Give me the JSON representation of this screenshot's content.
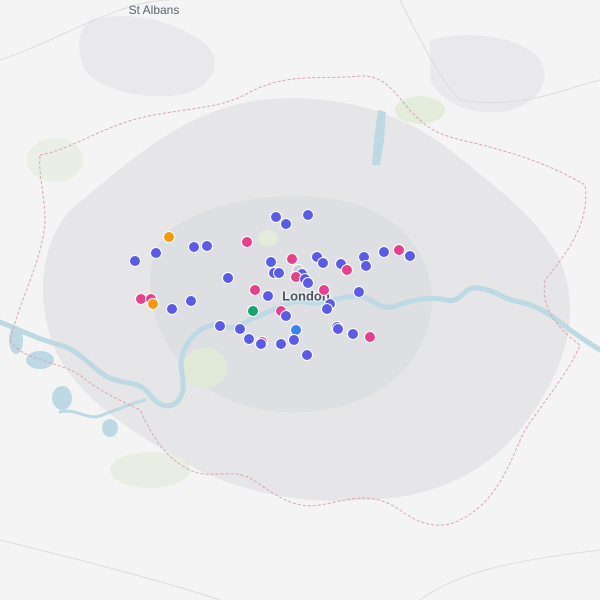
{
  "places": {
    "st_albans": "St Albans",
    "london": "London"
  },
  "colors": {
    "land": "#f4f4f4",
    "urban": "#e3e3e5",
    "park": "#e4eddc",
    "water": "#bcd9e4",
    "boundary": "#d9a4a8",
    "purple": "#5b5ce6",
    "pink": "#e5418c",
    "orange": "#f19a0f",
    "green": "#1aa36e",
    "blue": "#3b82f0",
    "grey": "#c8d0dc"
  },
  "markers": [
    {
      "color": "purple",
      "lat": 51.6335,
      "lon": -0.2133
    },
    {
      "color": "purple",
      "lat": 51.6375,
      "lon": -0.1224
    },
    {
      "color": "purple",
      "lat": 51.6201,
      "lon": -0.1867
    },
    {
      "color": "orange",
      "lat": 51.5967,
      "lon": -0.5221
    },
    {
      "color": "purple",
      "lat": 51.5789,
      "lon": -0.4506
    },
    {
      "color": "purple",
      "lat": 51.5811,
      "lon": -0.4132
    },
    {
      "color": "pink",
      "lat": 51.5882,
      "lon": -0.2985
    },
    {
      "color": "purple",
      "lat": 51.5685,
      "lon": -0.5609
    },
    {
      "color": "purple",
      "lat": 51.5533,
      "lon": -0.6221
    },
    {
      "color": "purple",
      "lat": 51.553,
      "lon": -0.2299
    },
    {
      "color": "pink",
      "lat": 51.5574,
      "lon": -0.168
    },
    {
      "color": "purple",
      "lat": 51.5604,
      "lon": -0.0965
    },
    {
      "color": "purple",
      "lat": 51.5511,
      "lon": -0.0789
    },
    {
      "color": "purple",
      "lat": 51.5493,
      "lon": -0.0269
    },
    {
      "color": "purple",
      "lat": 51.5616,
      "lon": 0.0387
    },
    {
      "color": "purple",
      "lat": 51.5696,
      "lon": 0.0988
    },
    {
      "color": "pink",
      "lat": 51.5745,
      "lon": 0.1404
    },
    {
      "color": "purple",
      "lat": 51.5631,
      "lon": 0.1728
    },
    {
      "color": "purple",
      "lat": 51.5443,
      "lon": 0.0468
    },
    {
      "color": "pink",
      "lat": 51.5373,
      "lon": -0.0107
    },
    {
      "color": "grey",
      "lat": 51.5382,
      "lon": -0.1496
    },
    {
      "color": "purple",
      "lat": 51.5333,
      "lon": -0.2215
    },
    {
      "color": "purple",
      "lat": 51.5318,
      "lon": -0.2048
    },
    {
      "color": "purple",
      "lat": 51.5315,
      "lon": -0.1395
    },
    {
      "color": "pink",
      "lat": 51.525,
      "lon": -0.1553
    },
    {
      "color": "purple",
      "lat": 51.5208,
      "lon": -0.1294
    },
    {
      "color": "purple",
      "lat": 51.5147,
      "lon": -0.123
    },
    {
      "color": "purple",
      "lat": 51.5231,
      "lon": -0.3522
    },
    {
      "color": "pink",
      "lat": 51.5011,
      "lon": -0.2761
    },
    {
      "color": "pink",
      "lat": 51.5011,
      "lon": -0.0769
    },
    {
      "color": "purple",
      "lat": 51.4987,
      "lon": 0.0247
    },
    {
      "color": "purple",
      "lat": 51.4919,
      "lon": -0.2376
    },
    {
      "color": "pink",
      "lat": 51.4855,
      "lon": -0.6046
    },
    {
      "color": "pink",
      "lat": 51.4849,
      "lon": -0.575
    },
    {
      "color": "purple",
      "lat": 51.4824,
      "lon": -0.4587
    },
    {
      "color": "orange",
      "lat": 51.4773,
      "lon": -0.57
    },
    {
      "color": "purple",
      "lat": 51.4767,
      "lon": -0.0595
    },
    {
      "color": "purple",
      "lat": 51.4683,
      "lon": -0.0678
    },
    {
      "color": "purple",
      "lat": 51.4674,
      "lon": -0.516
    },
    {
      "color": "green",
      "lat": 51.4646,
      "lon": -0.28
    },
    {
      "color": "pink",
      "lat": 51.4644,
      "lon": -0.2001
    },
    {
      "color": "purple",
      "lat": 51.4552,
      "lon": -0.1844
    },
    {
      "color": "purple",
      "lat": 51.4376,
      "lon": -0.3763
    },
    {
      "color": "purple",
      "lat": 51.4317,
      "lon": -0.3172
    },
    {
      "color": "blue",
      "lat": 51.4302,
      "lon": -0.157
    },
    {
      "color": "purple",
      "lat": 51.4353,
      "lon": -0.0373
    },
    {
      "color": "purple",
      "lat": 51.431,
      "lon": -0.0355
    },
    {
      "color": "purple",
      "lat": 51.4226,
      "lon": 0.0091
    },
    {
      "color": "pink",
      "lat": 51.4168,
      "lon": 0.0558
    },
    {
      "color": "purple",
      "lat": 51.4135,
      "lon": -0.2918
    },
    {
      "color": "pink",
      "lat": 51.4076,
      "lon": -0.2545
    },
    {
      "color": "purple",
      "lat": 51.405,
      "lon": -0.2566
    },
    {
      "color": "purple",
      "lat": 51.4054,
      "lon": -0.2005
    },
    {
      "color": "purple",
      "lat": 51.4127,
      "lon": -0.1611
    },
    {
      "color": "purple",
      "lat": 51.3847,
      "lon": -0.1236
    }
  ]
}
